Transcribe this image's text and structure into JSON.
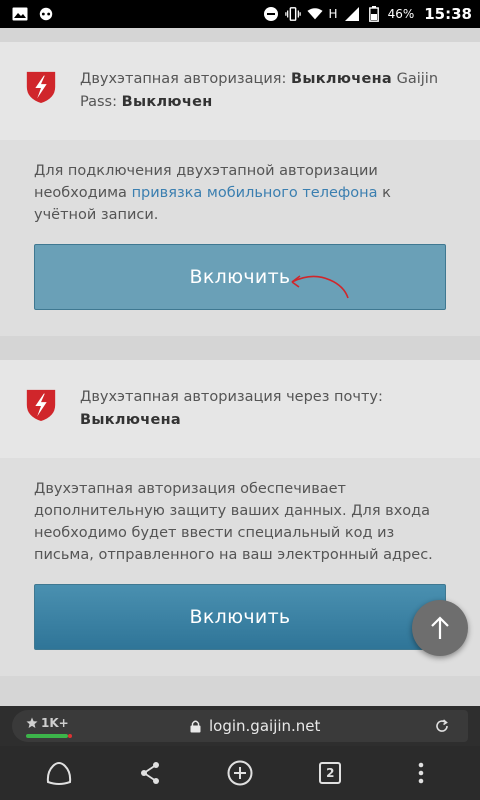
{
  "status_bar": {
    "network_type": "H",
    "battery": "46%",
    "time": "15:38"
  },
  "section1": {
    "header_prefix": "Двухэтапная авторизация: ",
    "header_status": "Выключена",
    "header_mid": " Gaijin Pass: ",
    "header_status2": "Выключен",
    "body_prefix": "Для подключения двухэтапной авторизации необходима ",
    "body_link": "привязка мобильного телефона",
    "body_suffix": " к учётной записи.",
    "button_label": "Включить"
  },
  "section2": {
    "header_prefix": "Двухэтапная авторизация через почту: ",
    "header_status": "Выключена",
    "body_text": "Двухэтапная авторизация обеспечивает дополнительную защиту ваших данных. Для входа необходимо будет ввести специальный код из письма, отправленного на ваш электронный адрес.",
    "button_label": "Включить"
  },
  "browser": {
    "rating": "1K+",
    "url": "login.gaijin.net",
    "tab_count": "2"
  },
  "colors": {
    "shield_red": "#d0262b",
    "link_blue": "#3b7fb0",
    "button_blue": "#3f86a8"
  },
  "icons": [
    "image-icon",
    "assistant-icon",
    "dnd-icon",
    "vibrate-icon",
    "wifi-icon",
    "signal-icon",
    "battery-icon",
    "shield-icon",
    "arrow-up-icon",
    "star-icon",
    "lock-icon",
    "reload-icon",
    "alice-icon",
    "share-icon",
    "plus-icon",
    "menu-icon"
  ]
}
